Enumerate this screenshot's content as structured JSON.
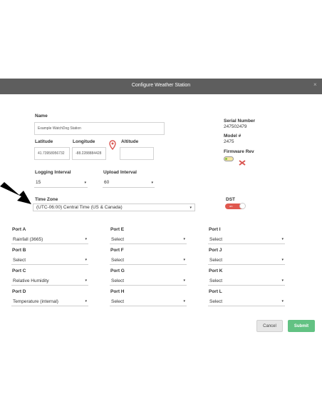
{
  "modal": {
    "title": "Configure Weather Station",
    "close": "×"
  },
  "station": {
    "name_label": "Name",
    "name_value": "Example WatchDog Station",
    "latitude_label": "Latitude",
    "latitude_value": "41.73958956732",
    "longitude_label": "Longitude",
    "longitude_value": "-88.2288884428",
    "altitude_label": "Altitude",
    "altitude_value": ""
  },
  "info": {
    "serial_label": "Serial Number",
    "serial_value": "247502479",
    "model_label": "Model #",
    "model_value": "2475",
    "firmware_label": "Firmware Rev"
  },
  "intervals": {
    "logging_label": "Logging Interval",
    "logging_value": "15",
    "upload_label": "Upload Interval",
    "upload_value": "60"
  },
  "timezone": {
    "label": "Time Zone",
    "value": "(UTC-06:00) Central Time (US & Canada)"
  },
  "dst": {
    "label": "DST",
    "toggle_text": "on"
  },
  "ports": [
    {
      "label": "Port A",
      "value": "Rainfall (3665)"
    },
    {
      "label": "Port B",
      "value": "Select"
    },
    {
      "label": "Port C",
      "value": "Relative Humidity"
    },
    {
      "label": "Port D",
      "value": "Temperature (internal)"
    },
    {
      "label": "Port E",
      "value": "Select"
    },
    {
      "label": "Port F",
      "value": "Select"
    },
    {
      "label": "Port G",
      "value": "Select"
    },
    {
      "label": "Port H",
      "value": "Select"
    },
    {
      "label": "Port I",
      "value": "Select"
    },
    {
      "label": "Port J",
      "value": "Select"
    },
    {
      "label": "Port K",
      "value": "Select"
    },
    {
      "label": "Port L",
      "value": "Select"
    }
  ],
  "caret": "▾",
  "buttons": {
    "cancel": "Cancel",
    "submit": "Submit"
  },
  "colors": {
    "header": "#5e5e5e",
    "submit": "#62c283",
    "dst_toggle": "#e0584f",
    "map_pin": "#d9534f"
  }
}
